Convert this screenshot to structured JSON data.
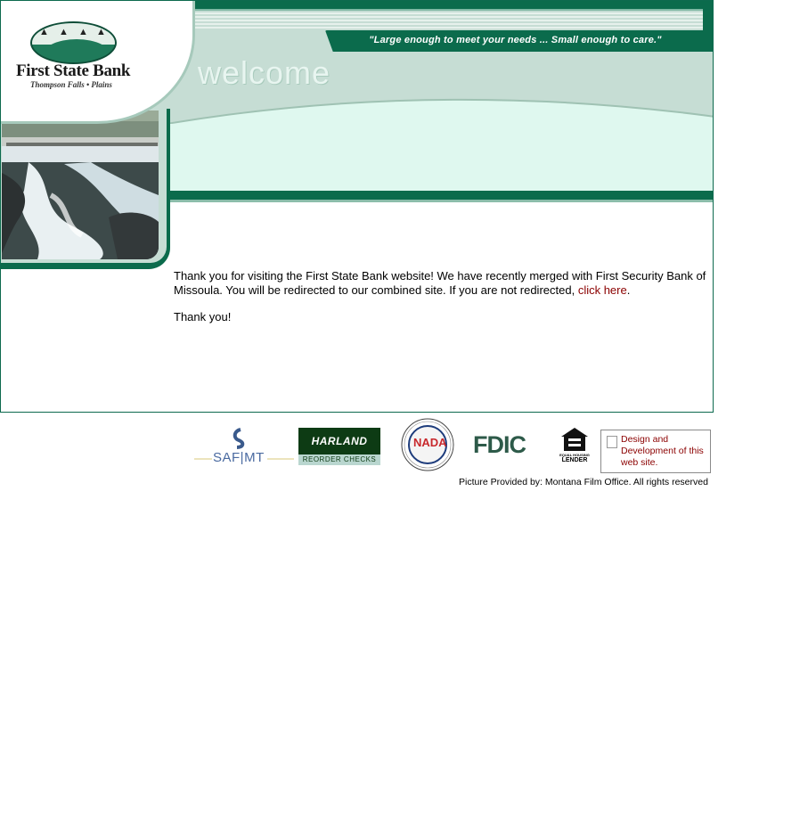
{
  "header": {
    "bank_name": "First State Bank",
    "bank_locations": "Thompson Falls • Plains",
    "tagline": "\"Large enough to meet your needs ... Small enough to care.\"",
    "welcome": "welcome"
  },
  "main": {
    "message_before_link": "Thank you for visiting the First State Bank website! We have recently merged with First Security Bank of Missoula. You will be redirected to our combined site. If you are not redirected, ",
    "link_text": "click here",
    "message_after_link": ".",
    "thanks": "Thank you!"
  },
  "footer": {
    "saf_label": "SAF|MT",
    "harland_title": "HARLAND",
    "harland_sub": "REORDER CHECKS",
    "nada_label": "NADA",
    "nada_ring": "NATIONAL AUTOMOBILE DEALERS ASSOCIATION",
    "fdic_label": "FDIC",
    "equal_housing_line1": "EQUAL HOUSING",
    "equal_housing_line2": "LENDER",
    "design_link": "Design and Development of this web site.",
    "credit": "Picture Provided by: Montana Film Office. All rights reserved"
  },
  "colors": {
    "brand_green": "#0b6b4c",
    "mint": "#dff8ef",
    "link": "#8b0000"
  },
  "icons": {
    "broken_image": "document-icon",
    "equal_housing": "house-icon"
  }
}
